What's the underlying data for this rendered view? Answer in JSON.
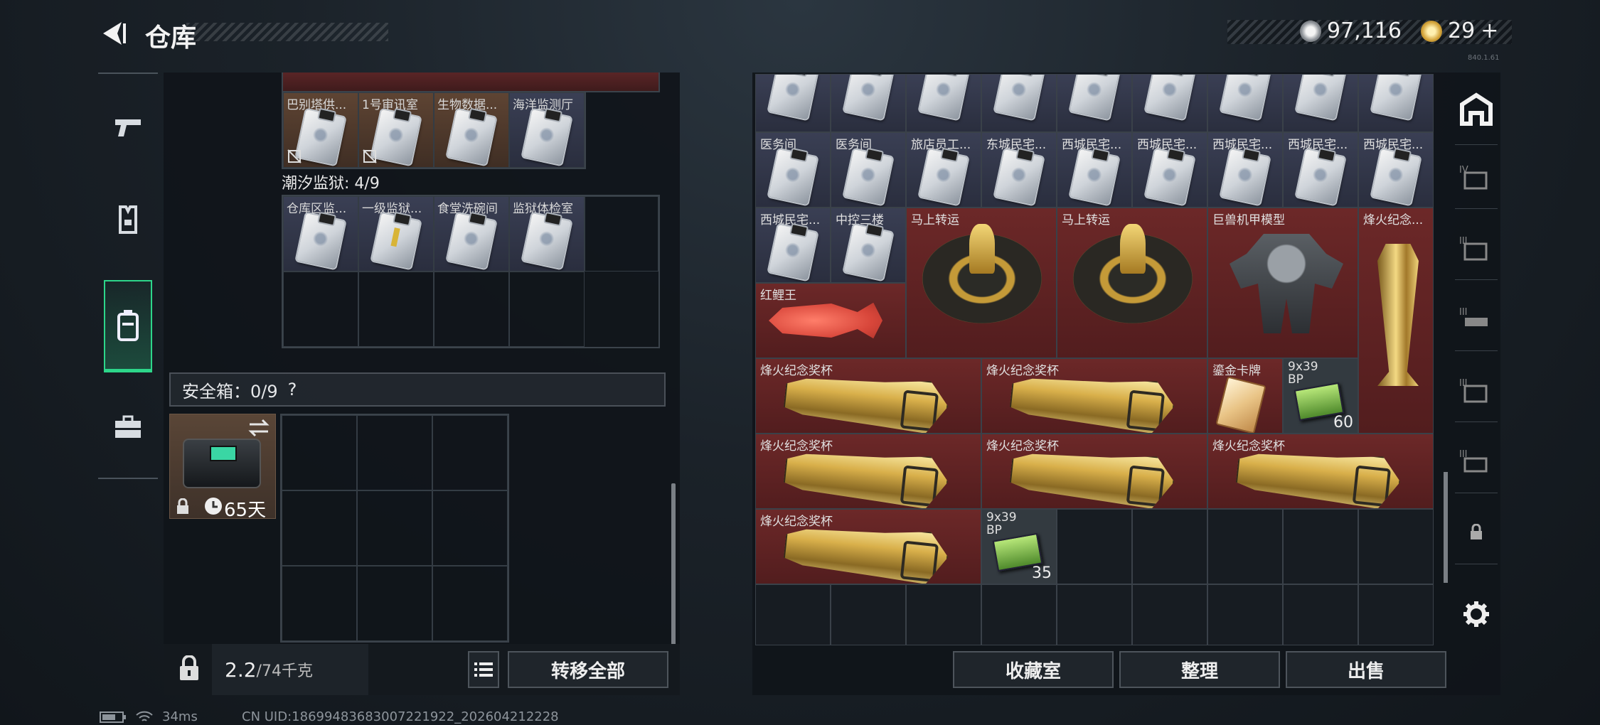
{
  "header": {
    "title": "仓库"
  },
  "currency": {
    "silver": "97,116",
    "gold": "29",
    "plus": "+"
  },
  "left_nav": {
    "items": [
      "weapon",
      "armor",
      "backpack",
      "toolbox"
    ],
    "active": 2
  },
  "left_panel": {
    "rowA_labels": [
      "巴别塔供...",
      "1号审讯室",
      "生物数据...",
      "海洋监测厅"
    ],
    "section_title": "潮汐监狱: 4/9",
    "rowB_labels": [
      "仓库区监...",
      "一级监狱...",
      "食堂洗碗间",
      "监狱体检室"
    ],
    "safebox_label": "安全箱：0/9",
    "safebox_help": "?",
    "safebox_timer": "65天",
    "weight": "2.2",
    "weight_unit": "/74千克",
    "transfer_all": "转移全部"
  },
  "right_panel": {
    "row1_labels": [
      "",
      "",
      "",
      "",
      "",
      "",
      "",
      "",
      ""
    ],
    "row2_labels": [
      "医务间",
      "医务间",
      "旅店员工...",
      "东城民宅...",
      "西城民宅...",
      "西城民宅...",
      "西城民宅...",
      "西城民宅...",
      "西城民宅..."
    ],
    "row3_labels": [
      "西城民宅...",
      "中控三楼"
    ],
    "item_lucky1": "马上转运",
    "item_lucky2": "马上转运",
    "item_mech": "巨兽机甲模型",
    "item_tall": "烽火纪念...",
    "item_fish": "红鲤王",
    "trophy_label": "烽火纪念奖杯",
    "goldcard_label": "鎏金卡牌",
    "ammo1_label": "9x39\nBP",
    "ammo1_qty": "60",
    "ammo2_label": "9x39\nBP",
    "ammo2_qty": "35",
    "buttons": {
      "collection": "收藏室",
      "sort": "整理",
      "sell": "出售"
    }
  },
  "footer": {
    "ping": "34ms",
    "uid": "CN UID:18699483683007221922_202604212228",
    "build": "840.1.61"
  },
  "colors": {
    "active_green": "#2dd68a",
    "red_cell": "#6c2828",
    "blue_cell": "#3a3f54"
  }
}
